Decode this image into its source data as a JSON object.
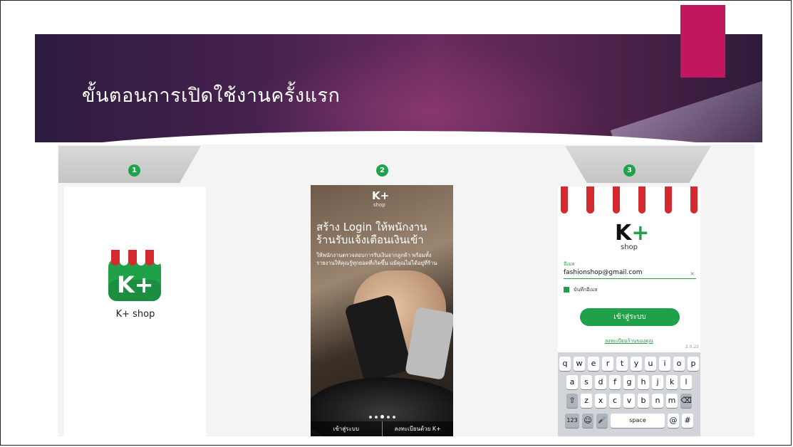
{
  "slide": {
    "title": "ขั้นตอนการเปิดใช้งานครั้งแรก",
    "accent_color": "#c0175f",
    "banner_colors": [
      "#2c1b3f",
      "#6a2c5e"
    ]
  },
  "steps": [
    {
      "number": "1"
    },
    {
      "number": "2"
    },
    {
      "number": "3"
    }
  ],
  "step_badge_color": "#1ea34a",
  "panel1": {
    "app_icon": "kplus-shop-icon",
    "app_label": "K+ shop"
  },
  "panel2": {
    "logo": "K+",
    "logo_sub": "shop",
    "headline": "สร้าง Login ให้พนักงาน ร้านรับแจ้งเตือนเงินเข้า",
    "subtext": "ให้พนักงานตรวจสอบการรับเงินจากลูกค้า พร้อมทั้งรายงานให้คุณรู้ทุกยอดที่เกิดขึ้น แม้คุณไม่ได้อยู่ที่ร้าน",
    "login_btn": "เข้าสู่ระบบ",
    "register_btn": "ลงทะเบียนด้วย K+"
  },
  "panel3": {
    "logo_k": "K",
    "logo_plus": "+",
    "logo_sub": "shop",
    "email_label": "อีเมล",
    "email_value": "fashionshop@gmail.com",
    "clear_icon": "×",
    "remember_label": "บันทึกอีเมล",
    "login_btn": "เข้าสู่ระบบ",
    "register_link": "ลงทะเบียนร้านของคุณ",
    "version": "2.0.22",
    "keyboard": {
      "row1": [
        "q",
        "w",
        "e",
        "r",
        "t",
        "y",
        "u",
        "i",
        "o",
        "p"
      ],
      "row2": [
        "a",
        "s",
        "d",
        "f",
        "g",
        "h",
        "j",
        "k",
        "l"
      ],
      "row3": [
        "⇧",
        "z",
        "x",
        "c",
        "v",
        "b",
        "n",
        "m",
        "⌫"
      ],
      "row4": [
        "123",
        "☺",
        "🎤",
        "space",
        "@",
        "#"
      ]
    }
  }
}
